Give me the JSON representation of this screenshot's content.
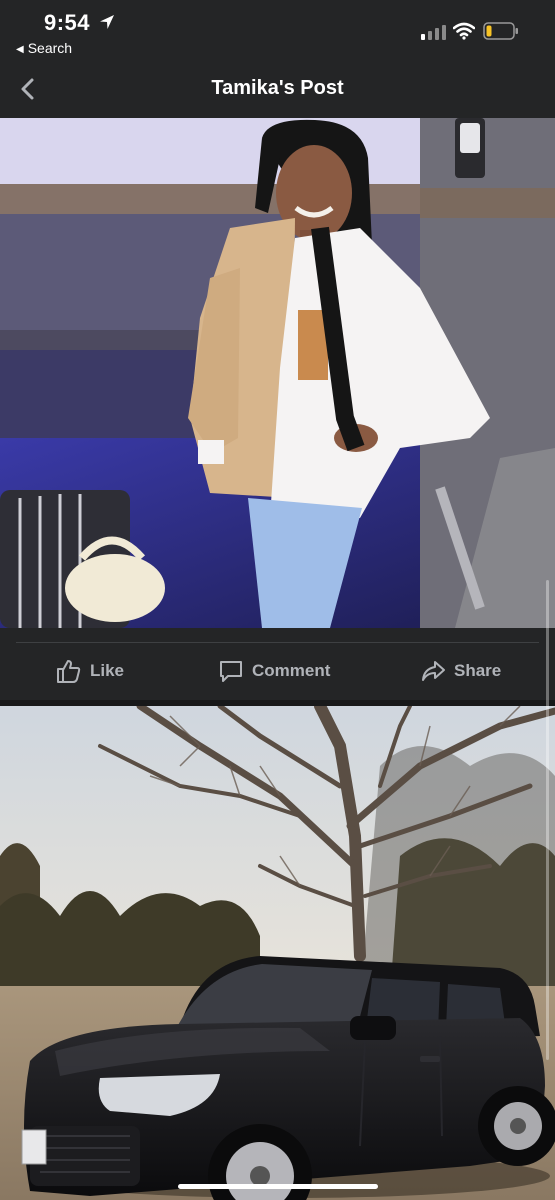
{
  "status": {
    "time": "9:54",
    "back_app": "Search"
  },
  "nav": {
    "title": "Tamika's Post"
  },
  "actions": {
    "like": "Like",
    "comment": "Comment",
    "share": "Share"
  },
  "colors": {
    "background": "#242526",
    "text": "#e4e6eb",
    "muted": "#b0b3b8",
    "battery": "#f7c325"
  },
  "icons": [
    "location-arrow-icon",
    "signal-icon",
    "wifi-icon",
    "battery-icon",
    "back-chevron-icon",
    "like-icon",
    "comment-icon",
    "share-icon"
  ]
}
